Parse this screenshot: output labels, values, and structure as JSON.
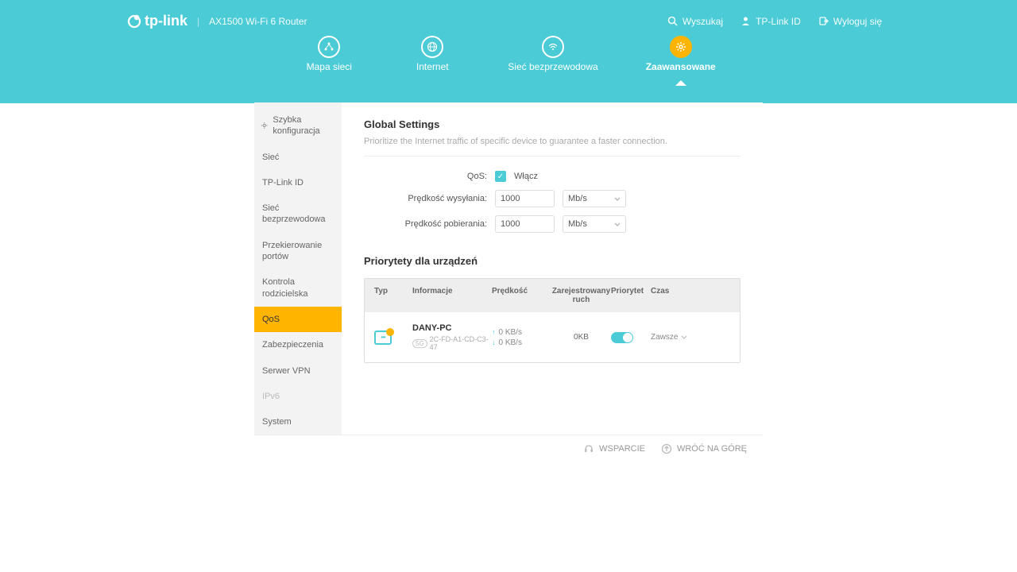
{
  "header": {
    "brand": "tp-link",
    "model": "AX1500 Wi-Fi 6 Router",
    "actions": {
      "search": "Wyszukaj",
      "id": "TP-Link ID",
      "logout": "Wyloguj się"
    }
  },
  "nav": {
    "map": "Mapa sieci",
    "internet": "Internet",
    "wireless": "Sieć bezprzewodowa",
    "advanced": "Zaawansowane"
  },
  "sidebar": {
    "quick": "Szybka konfiguracja",
    "items": [
      "Sieć",
      "TP-Link ID",
      "Sieć bezprzewodowa",
      "Przekierowanie portów",
      "Kontrola rodzicielska",
      "QoS",
      "Zabezpieczenia",
      "Serwer VPN",
      "IPv6",
      "System"
    ]
  },
  "global": {
    "title": "Global Settings",
    "subtitle": "Prioritize the Internet traffic of specific device to guarantee a faster connection.",
    "qos_label": "QoS:",
    "enable": "Włącz",
    "upload_label": "Prędkość wysyłania:",
    "download_label": "Prędkość pobierania:",
    "upload_value": "1000",
    "download_value": "1000",
    "unit": "Mb/s"
  },
  "priority": {
    "title": "Priorytety dla urządzeń",
    "cols": {
      "type": "Typ",
      "info": "Informacje",
      "speed": "Prędkość",
      "traffic": "Zarejestrowany ruch",
      "priority": "Priorytet",
      "time": "Czas"
    },
    "row": {
      "name": "DANY-PC",
      "band": "5G",
      "mac": "2C-FD-A1-CD-C3-47",
      "up": "0 KB/s",
      "down": "0 KB/s",
      "traffic": "0KB",
      "time": "Zawsze"
    }
  },
  "footer": {
    "support": "WSPARCIE",
    "top": "WRÓĆ NA GÓRĘ"
  }
}
